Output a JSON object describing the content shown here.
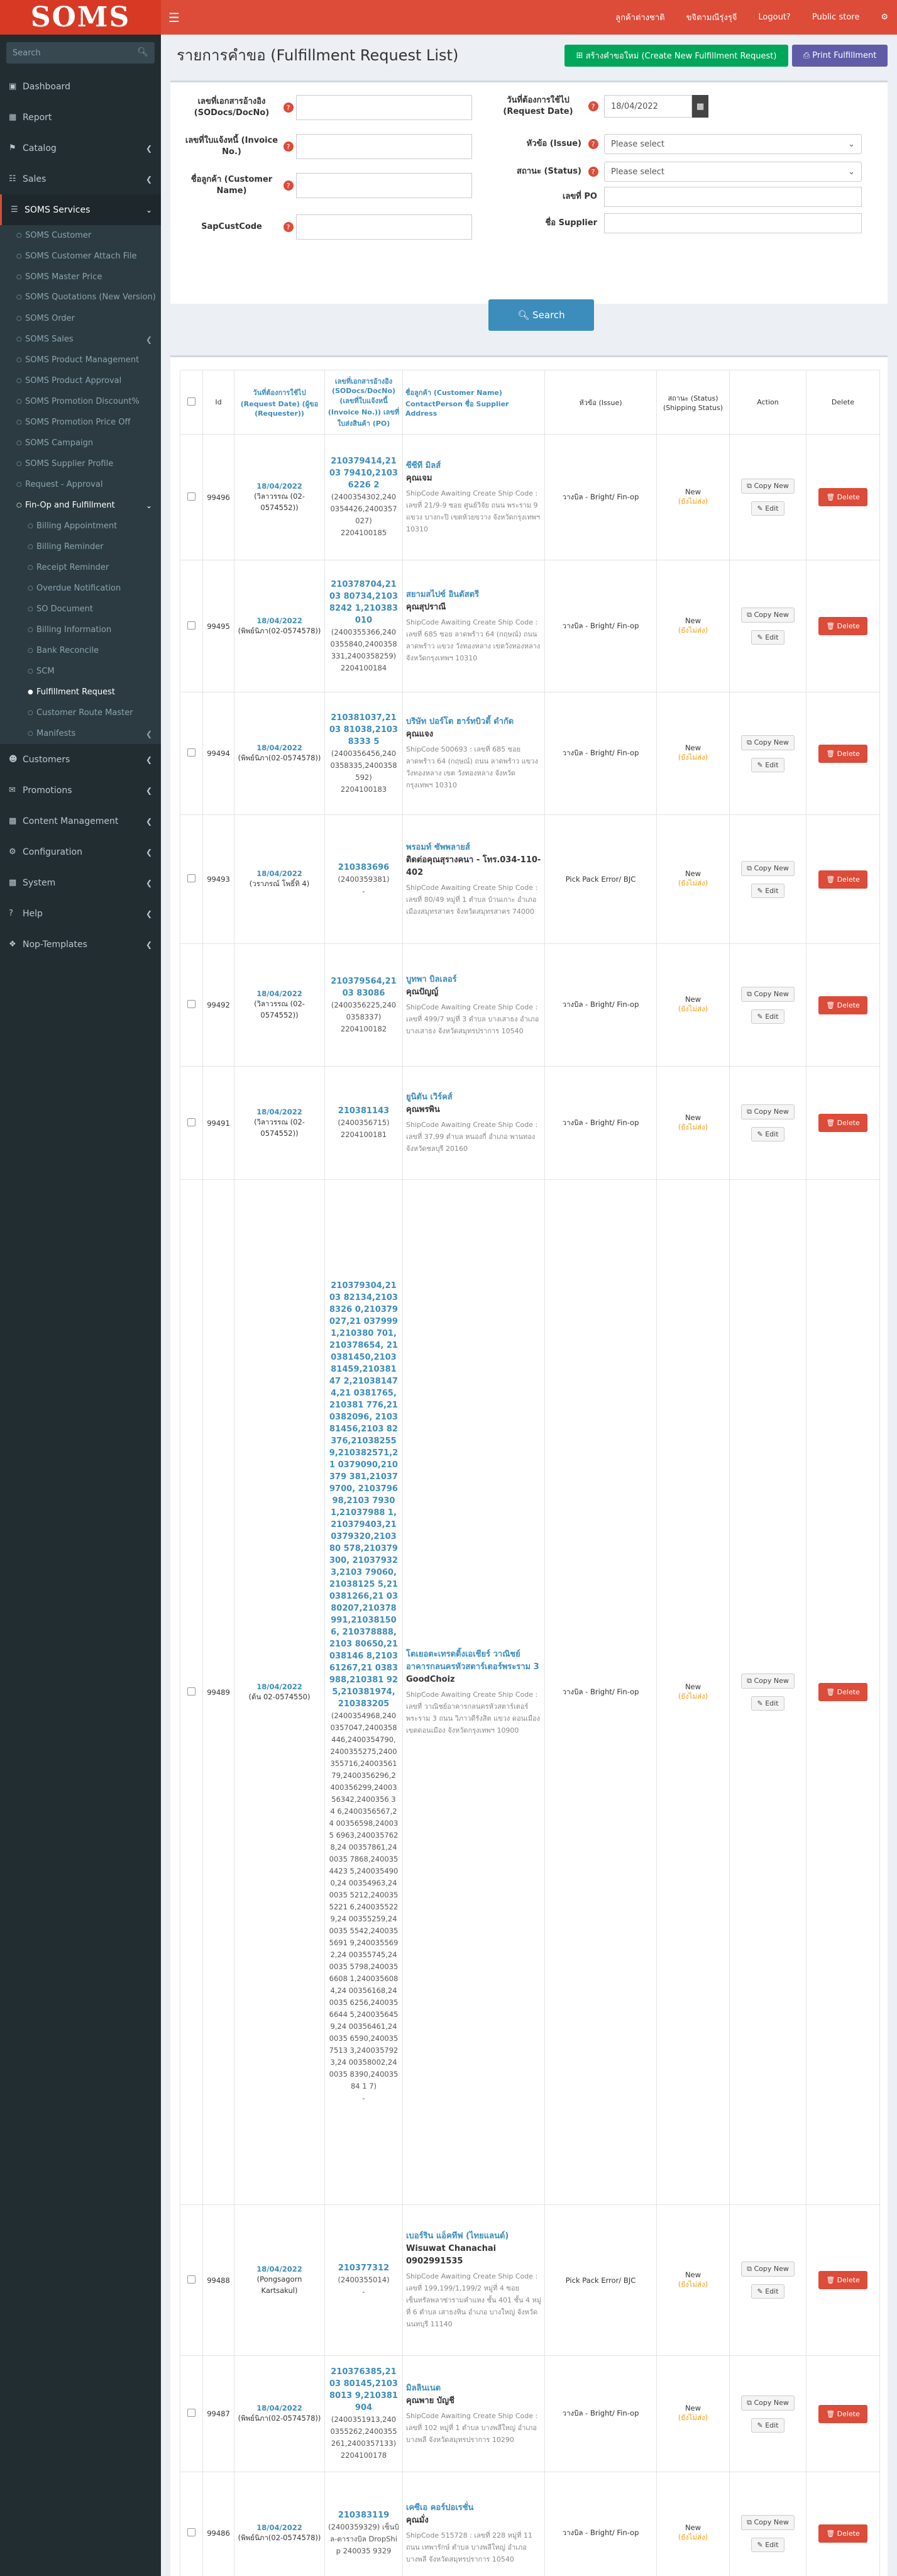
{
  "header": {
    "logo": "SOMS",
    "nav": [
      "ลูกค้าต่างชาติ",
      "ขจิตามณีรุ่งรุจี",
      "Logout?",
      "Public store"
    ]
  },
  "sidebar": {
    "search_placeholder": "Search",
    "top": [
      {
        "label": "Dashboard",
        "icon": "dashboard-icon"
      },
      {
        "label": "Report",
        "icon": "monitor-icon"
      },
      {
        "label": "Catalog",
        "icon": "tags-icon"
      },
      {
        "label": "Sales",
        "icon": "cart-icon"
      },
      {
        "label": "SOMS Services",
        "icon": "list-icon"
      }
    ],
    "soms_services": [
      "SOMS Customer",
      "SOMS Customer Attach File",
      "SOMS Master Price",
      "SOMS Quotations (New Version)",
      "SOMS Order",
      "SOMS Sales",
      "SOMS Product Management",
      "SOMS Product Approval",
      "SOMS Promotion Discount%",
      "SOMS Promotion Price Off",
      "SOMS Campaign",
      "SOMS Supplier Profile",
      "Request - Approval",
      "Fin-Op and Fulfillment"
    ],
    "fin_op": [
      "Billing Appointment",
      "Billing Reminder",
      "Receipt Reminder",
      "Overdue Notification",
      "SO Document",
      "Billing Information",
      "Bank Reconcile",
      "SCM",
      "Fulfillment Request",
      "Customer Route Master",
      "Manifests"
    ],
    "bottom": [
      {
        "label": "Customers",
        "icon": "user-icon"
      },
      {
        "label": "Promotions",
        "icon": "bullhorn-icon"
      },
      {
        "label": "Content Management",
        "icon": "cube-icon"
      },
      {
        "label": "Configuration",
        "icon": "gears-icon"
      },
      {
        "label": "System",
        "icon": "cube-icon"
      },
      {
        "label": "Help",
        "icon": "question-icon"
      },
      {
        "label": "Nop-Templates",
        "icon": "puzzle-icon"
      }
    ]
  },
  "page": {
    "title": "รายการคำขอ (Fulfillment Request List)",
    "create_button": "สร้างคำขอใหม่ (Create New Fulfillment Request)",
    "print_button": "Print Fulfillment"
  },
  "filters": {
    "so_docs_label": "เลขที่เอกสารอ้างอิง (SODocs/DocNo)",
    "invoice_label": "เลขที่ใบแจ้งหนี้ (Invoice No.)",
    "customer_label": "ชื่อลูกค้า (Customer Name)",
    "sapcust_label": "SapCustCode",
    "request_date_label": "วันที่ต้องการใช้ไป (Request Date)",
    "request_date_value": "18/04/2022",
    "issue_label": "หัวข้อ (Issue)",
    "issue_placeholder": "Please select",
    "status_label": "สถานะ (Status)",
    "status_placeholder": "Please select",
    "po_label": "เลขที่ PO",
    "supplier_label": "ชื่อ Supplier",
    "search_button": "Search"
  },
  "table": {
    "headers": {
      "id": "Id",
      "date": "วันที่ต้องการใช้ไป (Request Date) (ผู้ขอ (Requester))",
      "so": "เลขที่เอกสารอ้างอิง (SODocs/DocNo) (เลขที่ใบแจ้งหนี้ (Invoice No.)) เลขที่ใบส่งสินค้า (PO)",
      "customer": "ชื่อลูกค้า (Customer Name) ContactPerson ชื่อ Supplier Address",
      "issue": "หัวข้อ (Issue)",
      "status": "สถานะ (Status) (Shipping Status)",
      "action": "Action",
      "delete": "Delete"
    },
    "buttons": {
      "copy": "Copy New",
      "edit": "Edit",
      "delete": "Delete"
    },
    "rows": [
      {
        "id": "99496",
        "date": "18/04/2022",
        "requester": "(วิลาวรรณ (02-0574552))",
        "so": "210379414,2103 79410,21036226 2",
        "inv": "(2400354302,240 0354426,2400357 027)",
        "po": "2204100185",
        "customer": "ซีซีที มิลส์",
        "contact": "คุณเจม",
        "address": "ShipCode Awaiting Create Ship Code : เลขที่ 21/9-9 ซอย ศูนย์วิจัย ถนน พระราม 9 แขวง บางกะปิ เขตห้วยขวาง จังหวัดกรุงเทพฯ 10310",
        "issue": "วางบิล - Bright/ Fin-op",
        "status": "New",
        "shipping": "(ยังไม่ส่ง)"
      },
      {
        "id": "99495",
        "date": "18/04/2022",
        "requester": "(พิพย์นิภา(02-0574578))",
        "so": "210378704,2103 80734,21038242 1,210383010",
        "inv": "(2400355366,240 0355840,2400358 331,2400358259)",
        "po": "2204100184",
        "customer": "สยามสไปซ์ อินดัสตรี",
        "contact": "คุณสุปราณี",
        "address": "ShipCode Awaiting Create Ship Code : เลขที่ 685 ซอย ลาดพร้าว 64 (กฤษณ์) ถนน ลาดพร้าว แขวง วังทองหลาง เขตวังทองหลาง จังหวัดกรุงเทพฯ 10310",
        "issue": "วางบิล - Bright/ Fin-op",
        "status": "New",
        "shipping": "(ยังไม่ส่ง)"
      },
      {
        "id": "99494",
        "date": "18/04/2022",
        "requester": "(พิพย์นิภา(02-0574578))",
        "so": "210381037,2103 81038,21038333 5",
        "inv": "(2400356456,240 0358335,2400358 592)",
        "po": "2204100183",
        "customer": "บริษัท ปอร์โต ฮาร์ทบิวตี้ ดำกัด",
        "contact": "คุณแจง",
        "address": "ShipCode 500693 : เลขที่ 685 ซอย ลาดพร้าว 64 (กฤษณ์) ถนน ลาดพร้าว แขวง วังทองหลาง เขต วังทองหลาง จังหวัด กรุงเทพฯ 10310",
        "issue": "วางบิล - Bright/ Fin-op",
        "status": "New",
        "shipping": "(ยังไม่ส่ง)"
      },
      {
        "id": "99493",
        "date": "18/04/2022",
        "requester": "(วราภรณ์ โพธิ์ทิ 4)",
        "so": "210383696",
        "inv": "(2400359381)",
        "po": "-",
        "customer": "พรอมท์ ซัพพลายส์",
        "contact": "ติดต่อคุณสุรางคนา - โทร.034-110-402",
        "address": "ShipCode Awaiting Create Ship Code : เลขที่ 80/49 หมู่ที่ 1 ตำบล บ้านเกาะ อำเภอเมืองสมุทรสาคร จังหวัดสมุทรสาคร 74000",
        "issue": "Pick Pack Error/ BJC",
        "status": "New",
        "shipping": "(ยังไม่ส่ง)"
      },
      {
        "id": "99492",
        "date": "18/04/2022",
        "requester": "(วิลาวรรณ (02-0574552))",
        "so": "210379564,2103 83086",
        "inv": "(2400356225,240 0358337)",
        "po": "2204100182",
        "customer": "บูทพา บิลเลอร์",
        "contact": "คุณปัญญ์",
        "address": "ShipCode Awaiting Create Ship Code : เลขที่ 499/7 หมู่ที่ 3 ตำบล บางเสาธง อำเภอบางเสาธง จังหวัดสมุทรปราการ 10540",
        "issue": "วางบิล - Bright/ Fin-op",
        "status": "New",
        "shipping": "(ยังไม่ส่ง)"
      },
      {
        "id": "99491",
        "date": "18/04/2022",
        "requester": "(วิลาวรรณ (02-0574552))",
        "so": "210381143",
        "inv": "(2400356715)",
        "po": "2204100181",
        "customer": "ยูนิตัน เวิร์คส์",
        "contact": "คุณพรพิน",
        "address": "ShipCode Awaiting Create Ship Code : เลขที่ 37,99 ตำบล หนองกี่ อำเภอ พานทอง จังหวัดชลบุรี 20160",
        "issue": "วางบิล - Bright/ Fin-op",
        "status": "New",
        "shipping": "(ยังไม่ส่ง)"
      },
      {
        "id": "99489",
        "date": "18/04/2022",
        "requester": "(ต้น 02-0574550)",
        "so": "210379304,2103 82134,21038326 0,210379027,21 0379991,210380 701,210378654, 210381450,2103 81459,21038147 2,210381474,21 0381765,210381 776,210382096, 210381456,2103 82376,21038255 9,210382571,21 0379090,210379 381,210379700, 210379698,2103 79301,21037988 1,210379403,21 0379320,210380 578,210379300, 210379323,2103 79060,21038125 5,210381266,21 0380207,210378 991,210381506, 210378888,2103 80650,21038146 8,210361267,21 0383988,210381 925,210381974, 210383205",
        "inv": "(2400354968,240 0357047,2400358 446,2400354790, 2400355275,2400 355716,24003561 79,2400356296,2 400356299,24003 56342,2400356 3 4 6,2400356567,24 00356598,240035 6963,2400357628,24 00357861,240035 7868,2400354423 5,2400354900,24 00354963,240035 5212,2400355221 6,2400355229,24 00355259,240035 5542,2400355691 9,2400355692,24 00355745,240035 5798,2400356608 1,2400356084,24 00356168,240035 6256,2400356644 5,2400356459,24 00356461,240035 6590,2400357513 3,2400357923,24 00358002,240035 8390,24003584 1 7)",
        "po": "-",
        "customer": "โตเยอตะเทรดดิ้งเอเชียร์ วาณิชย์อาคารกลนครหัวสตาร์เตอร์พระราม 3",
        "contact": "GoodChoiz",
        "address": "ShipCode Awaiting Create Ship Code : เลขที่ วาณิชย์อาคารกลนครหัวสตาร์เตอร์ พระราม 3 ถนน วิภาวดีรังสิต แขวง ดอนเมือง เขตดอนเมือง จังหวัดกรุงเทพฯ 10900",
        "issue": "วางบิล - Bright/ Fin-op",
        "status": "New",
        "shipping": "(ยังไม่ส่ง)"
      },
      {
        "id": "99488",
        "date": "18/04/2022",
        "requester": "(Pongsagorn Kartsakul)",
        "so": "210377312",
        "inv": "(2400355014)",
        "po": "-",
        "customer": "เบอร์ริน แอ็คทีฟ (ไทยแลนด์)",
        "contact": "Wisuwat Chanachai 0902991535",
        "address": "ShipCode Awaiting Create Ship Code : เลขที่ 199,199/1,199/2 หมู่ที่ 4 ซอย เซ็นทรัลพลาซ่ารามคำแหง ชั้น 401 ชั้น 4 หมู่ที่ 6 ตำบล เสาธงหิน อำเภอ บางใหญ่ จังหวัดนนทบุรี 11140",
        "issue": "Pick Pack Error/ BJC",
        "status": "New",
        "shipping": "(ยังไม่ส่ง)"
      },
      {
        "id": "99487",
        "date": "18/04/2022",
        "requester": "(พิพย์นิภา(02-0574578))",
        "so": "210376385,2103 80145,21038013 9,210381904",
        "inv": "(2400351913,240 0355262,2400355 261,2400357133)",
        "po": "2204100178",
        "customer": "มิลลินเนต",
        "contact": "คุณพาย บัญชี",
        "address": "ShipCode Awaiting Create Ship Code : เลขที่ 102 หมู่ที่ 1 ตำบล บางพลีใหญ่ อำเภอบางพลี จังหวัดสมุทรปราการ 10290",
        "issue": "วางบิล - Bright/ Fin-op",
        "status": "New",
        "shipping": "(ยังไม่ส่ง)"
      },
      {
        "id": "99486",
        "date": "18/04/2022",
        "requester": "(พิพย์นิภา(02-0574578))",
        "so": "210383119",
        "inv": "(2400359329) เซ็นบิล-ตารางบิล DropShip 240035 9329",
        "po": "",
        "customer": "เคซีเอ คอร์ปอเรชั่น",
        "contact": "คุณมั่ง",
        "address": "ShipCode 515728 : เลขที่ 228 หมู่ที่ 11 ถนน เทพารักษ์ ตำบล บางพลีใหญ่ อำเภอบางพลี จังหวัดสมุทรปราการ 10540",
        "issue": "วางบิล - Bright/ Fin-op",
        "status": "New",
        "shipping": "(ยังไม่ส่ง)"
      }
    ]
  },
  "colors": {
    "brand_red": "#dd4b39",
    "sidebar_bg": "#222d32",
    "accent_blue": "#3c8dbc",
    "green": "#00a65a",
    "purple": "#605ca8",
    "status_orange": "#f39c12"
  }
}
